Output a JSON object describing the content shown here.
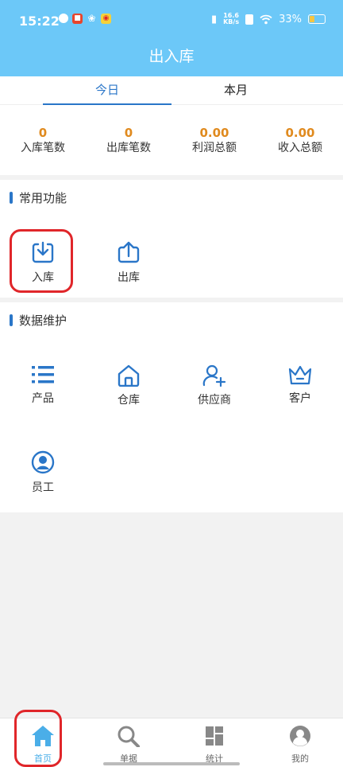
{
  "status_bar": {
    "time": "15:22",
    "net_speed_value": "16.6",
    "net_speed_unit": "KB/s",
    "battery": "33%"
  },
  "header": {
    "title": "出入库"
  },
  "tabs": [
    {
      "label": "今日",
      "active": true
    },
    {
      "label": "本月",
      "active": false
    }
  ],
  "stats": [
    {
      "value": "0",
      "label": "入库笔数"
    },
    {
      "value": "0",
      "label": "出库笔数"
    },
    {
      "value": "0.00",
      "label": "利润总额"
    },
    {
      "value": "0.00",
      "label": "收入总额"
    }
  ],
  "common_functions": {
    "title": "常用功能",
    "items": [
      {
        "label": "入库",
        "icon": "stock-in-icon"
      },
      {
        "label": "出库",
        "icon": "stock-out-icon"
      }
    ]
  },
  "data_maintenance": {
    "title": "数据维护",
    "items": [
      {
        "label": "产品",
        "icon": "list-icon"
      },
      {
        "label": "仓库",
        "icon": "warehouse-icon"
      },
      {
        "label": "供应商",
        "icon": "add-user-icon"
      },
      {
        "label": "客户",
        "icon": "crown-icon"
      },
      {
        "label": "员工",
        "icon": "user-icon"
      }
    ]
  },
  "bottom_nav": [
    {
      "label": "首页",
      "icon": "home-icon",
      "active": true
    },
    {
      "label": "单据",
      "icon": "search-icon",
      "active": false
    },
    {
      "label": "统计",
      "icon": "dashboard-icon",
      "active": false
    },
    {
      "label": "我的",
      "icon": "profile-icon",
      "active": false
    }
  ],
  "colors": {
    "header": "#6cc8f8",
    "accent": "#2a76c8",
    "stat_value": "#e08a1e",
    "highlight": "#e0262a"
  }
}
